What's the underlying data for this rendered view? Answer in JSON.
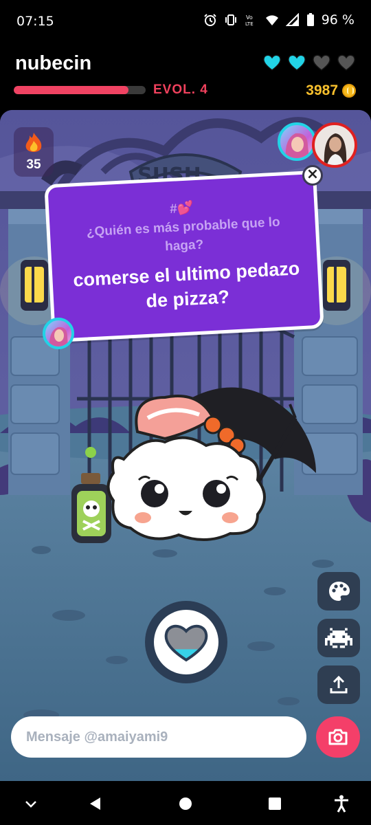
{
  "status_bar": {
    "time": "07:15",
    "network": "LTE",
    "battery": "96 %",
    "icons": [
      "alarm-icon",
      "vibrate-icon",
      "volte-icon",
      "wifi-icon",
      "signal-icon",
      "battery-icon"
    ]
  },
  "header": {
    "pet_name": "nubecin",
    "lives": {
      "filled": 2,
      "total": 4,
      "filled_color": "#22d3e6",
      "empty_color": "#555555"
    },
    "evolution": {
      "label": "EVOL. 4",
      "progress": 0.87,
      "color": "#f04363"
    },
    "coins": "3987"
  },
  "streak": {
    "count": "35",
    "icon": "flame-icon"
  },
  "question_card": {
    "tag": "#💕",
    "question": "¿Quién es más probable que lo haga?",
    "prompt": "comerse el ultimo pedazo de pizza?",
    "color": "#7b2fd6"
  },
  "side_actions": [
    {
      "name": "palette-button",
      "icon": "palette-icon"
    },
    {
      "name": "games-button",
      "icon": "space-invader-icon"
    },
    {
      "name": "share-button",
      "icon": "upload-icon"
    }
  ],
  "feed": {
    "icon": "heart-meter-icon",
    "level": 0.3
  },
  "message": {
    "placeholder": "Mensaje @amaiyami9"
  },
  "nav": [
    "chevron-down-icon",
    "back-icon",
    "home-icon",
    "recents-icon",
    "accessibility-icon"
  ]
}
